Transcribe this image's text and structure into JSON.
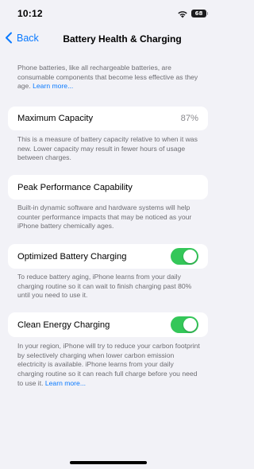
{
  "status": {
    "time": "10:12",
    "battery_level": "68",
    "icons": [
      "wifi-icon",
      "battery-icon"
    ]
  },
  "nav": {
    "back_label": "Back",
    "title": "Battery Health & Charging",
    "back_icon": "chevron-left-icon"
  },
  "intro": {
    "text": "Phone batteries, like all rechargeable batteries, are consumable components that become less effective as they age.",
    "link": "Learn more..."
  },
  "max_capacity": {
    "label": "Maximum Capacity",
    "value": "87%",
    "footnote": "This is a measure of battery capacity relative to when it was new. Lower capacity may result in fewer hours of usage between charges."
  },
  "peak_performance": {
    "label": "Peak Performance Capability",
    "footnote": "Built-in dynamic software and hardware systems will help counter performance impacts that may be noticed as your iPhone battery chemically ages."
  },
  "optimized_charging": {
    "label": "Optimized Battery Charging",
    "enabled": true,
    "footnote": "To reduce battery aging, iPhone learns from your daily charging routine so it can wait to finish charging past 80% until you need to use it."
  },
  "clean_energy": {
    "label": "Clean Energy Charging",
    "enabled": true,
    "footnote": "In your region, iPhone will try to reduce your carbon footprint by selectively charging when lower carbon emission electricity is available. iPhone learns from your daily charging routine so it can reach full charge before you need to use it.",
    "link": "Learn more..."
  },
  "colors": {
    "background": "#f2f2f7",
    "accent": "#0a7aff",
    "toggle_on": "#34c759",
    "secondary_text": "#6d6d72"
  }
}
